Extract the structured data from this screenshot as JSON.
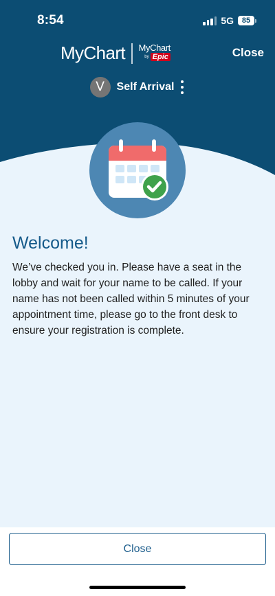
{
  "status_bar": {
    "time": "8:54",
    "network": "5G",
    "battery": "85"
  },
  "header": {
    "logo_text": "MyChart",
    "partner_logo_top": "MyChart",
    "partner_logo_by": "by",
    "partner_logo_brand": "Epic",
    "close_label": "Close"
  },
  "organization": {
    "avatar_letter": "V",
    "name": "Self Arrival"
  },
  "welcome": {
    "title": "Welcome!",
    "message": "We’ve checked you in. Please have a seat in the lobby and wait for your name to be called. If your name has not been called within 5 minutes of your appointment time, please go to the front desk to ensure your registration is complete."
  },
  "footer": {
    "close_button_label": "Close"
  },
  "icons": {
    "hero": "calendar-check-icon",
    "more": "more-vertical-icon",
    "signal": "cellular-signal-icon",
    "battery": "battery-icon"
  },
  "colors": {
    "header_blue": "#0c4d73",
    "page_background": "#eaf4fc",
    "accent_blue": "#1f5f8d",
    "hero_circle": "#4d87b3",
    "calendar_red": "#f06b6b",
    "check_green": "#3fa24b"
  }
}
